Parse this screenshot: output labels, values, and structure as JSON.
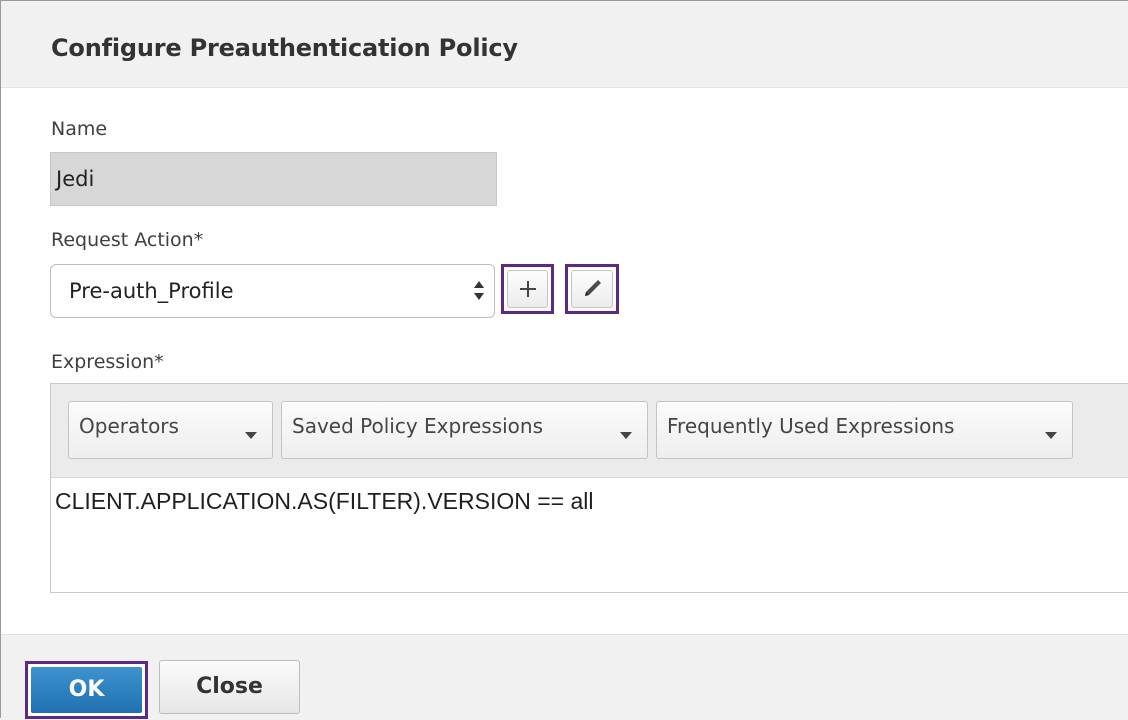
{
  "dialog": {
    "title": "Configure Preauthentication Policy"
  },
  "name_field": {
    "label": "Name",
    "value": "Jedi"
  },
  "request_action": {
    "label": "Request Action*",
    "selected": "Pre-auth_Profile",
    "add_button_symbol": "+",
    "add_icon": "plus-icon",
    "edit_icon": "pencil-icon"
  },
  "expression": {
    "label": "Expression*",
    "dropdowns": [
      {
        "label": "Operators"
      },
      {
        "label": "Saved Policy Expressions"
      },
      {
        "label": "Frequently Used Expressions"
      }
    ],
    "value": "CLIENT.APPLICATION.AS(FILTER).VERSION == all"
  },
  "footer": {
    "ok_label": "OK",
    "close_label": "Close"
  },
  "colors": {
    "focus_outline": "#5b2a86",
    "primary_button": "#2a7fc0",
    "header_bg": "#f1f1f1",
    "readonly_input_bg": "#d7d7d7"
  }
}
